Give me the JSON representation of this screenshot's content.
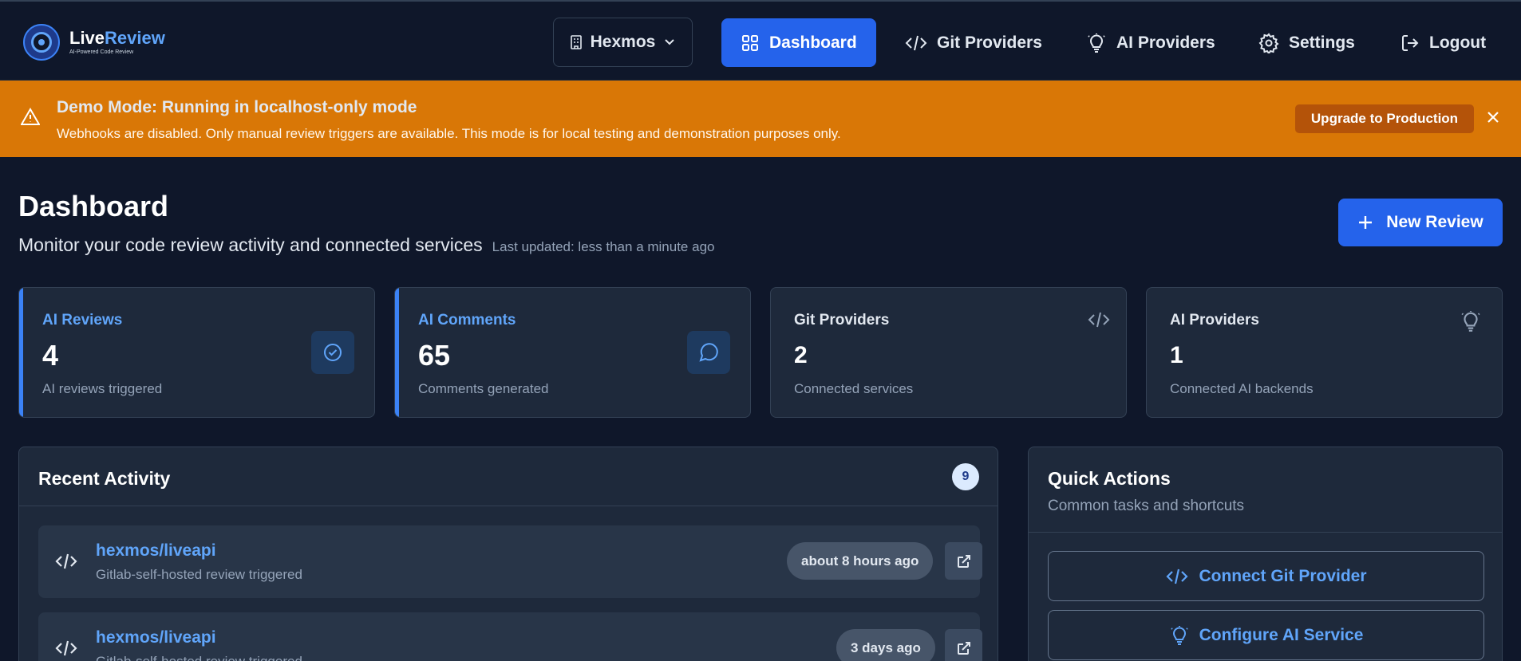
{
  "header": {
    "logo": {
      "title_part1": "Live",
      "title_part2": "Review",
      "subtitle": "AI-Powered Code Review"
    },
    "org_selector": {
      "label": "Hexmos"
    },
    "nav": [
      {
        "label": "Dashboard",
        "icon": "grid-icon",
        "active": true
      },
      {
        "label": "Git Providers",
        "icon": "code-icon",
        "active": false
      },
      {
        "label": "AI Providers",
        "icon": "lightbulb-icon",
        "active": false
      },
      {
        "label": "Settings",
        "icon": "gear-icon",
        "active": false
      },
      {
        "label": "Logout",
        "icon": "logout-icon",
        "active": false
      }
    ]
  },
  "banner": {
    "title": "Demo Mode: Running in localhost-only mode",
    "description": "Webhooks are disabled. Only manual review triggers are available. This mode is for local testing and demonstration purposes only.",
    "upgrade_label": "Upgrade to Production",
    "color": "#d97706"
  },
  "page": {
    "title": "Dashboard",
    "subtitle": "Monitor your code review activity and connected services",
    "last_updated": "Last updated: less than a minute ago",
    "new_review_label": "New Review"
  },
  "stats": [
    {
      "label": "AI Reviews",
      "value": "4",
      "description": "AI reviews triggered",
      "icon": "check-circle-icon"
    },
    {
      "label": "AI Comments",
      "value": "65",
      "description": "Comments generated",
      "icon": "message-circle-icon"
    },
    {
      "label": "Git Providers",
      "value": "2",
      "description": "Connected services",
      "icon": "code-icon"
    },
    {
      "label": "AI Providers",
      "value": "1",
      "description": "Connected AI backends",
      "icon": "lightbulb-icon"
    }
  ],
  "activity": {
    "title": "Recent Activity",
    "count": "9",
    "items": [
      {
        "repo": "hexmos/liveapi",
        "description": "Gitlab-self-hosted review triggered",
        "time": "about 8 hours ago"
      },
      {
        "repo": "hexmos/liveapi",
        "description": "Gitlab-self-hosted review triggered",
        "time": "3 days ago"
      }
    ]
  },
  "quick_actions": {
    "title": "Quick Actions",
    "subtitle": "Common tasks and shortcuts",
    "items": [
      {
        "label": "Connect Git Provider",
        "icon": "code-icon"
      },
      {
        "label": "Configure AI Service",
        "icon": "lightbulb-icon"
      }
    ]
  },
  "colors": {
    "background": "#0f172a",
    "card": "#1e293b",
    "accent": "#2563eb",
    "link": "#60a5fa",
    "warning": "#d97706"
  }
}
